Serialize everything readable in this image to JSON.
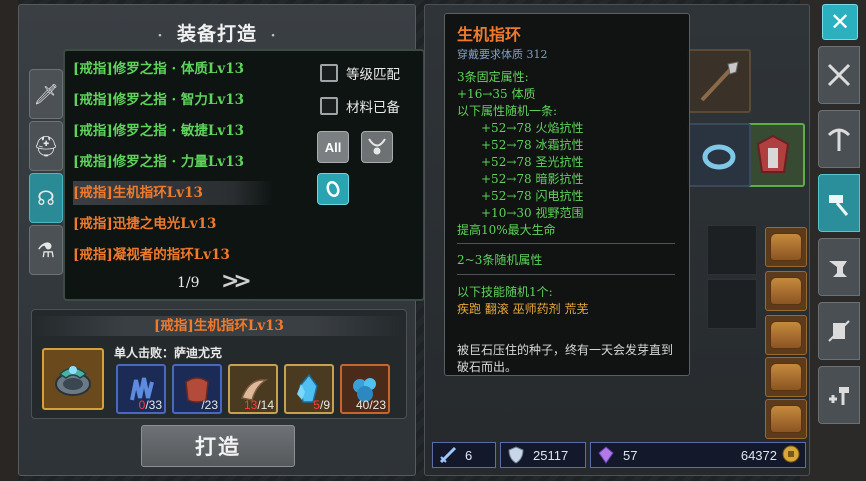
{
  "left_panel": {
    "title": "装备打造",
    "title_deco_left": "·",
    "title_deco_right": "·",
    "side_tabs": [
      {
        "icon": "sword-icon",
        "active": false
      },
      {
        "icon": "helmet-icon",
        "active": false
      },
      {
        "icon": "necklace-icon",
        "active": true
      },
      {
        "icon": "potion-icon",
        "active": false
      }
    ],
    "recipe_list": [
      {
        "label": "[戒指]修罗之指 · 体质Lv13",
        "rarity": "green"
      },
      {
        "label": "[戒指]修罗之指 · 智力Lv13",
        "rarity": "green"
      },
      {
        "label": "[戒指]修罗之指 · 敏捷Lv13",
        "rarity": "green"
      },
      {
        "label": "[戒指]修罗之指 · 力量Lv13",
        "rarity": "green"
      },
      {
        "label": "[戒指]生机指环Lv13",
        "rarity": "orange",
        "selected": true
      },
      {
        "label": "[戒指]迅捷之电光Lv13",
        "rarity": "orange"
      },
      {
        "label": "[戒指]凝视者的指环Lv13",
        "rarity": "orange"
      }
    ],
    "filters": {
      "level_match": "等级匹配",
      "materials_ready": "材料已备",
      "all_button": "All"
    },
    "pager": {
      "text": "1/9",
      "next": ">>"
    },
    "craft": {
      "item_name": "[戒指]生机指环Lv13",
      "kill_text": "单人击败：萨迪尤克",
      "materials": [
        {
          "name": "blue-gloves",
          "have": "0",
          "need": "/33",
          "enough": false
        },
        {
          "name": "red-leather",
          "have": "",
          "need": "/23",
          "enough": true
        },
        {
          "name": "claw",
          "have": "13",
          "need": "/14",
          "enough": false
        },
        {
          "name": "blue-crystal",
          "have": "5",
          "need": "/9",
          "enough": false
        },
        {
          "name": "blue-ore",
          "have": "40",
          "need": "/23",
          "enough": true
        }
      ],
      "button": "打造"
    }
  },
  "tooltip": {
    "title": "生机指环",
    "requirement": "穿戴要求体质  312",
    "fixed_header": "3条固定属性:",
    "fixed_1": "+16→35  体质",
    "random_header": "以下属性随机一条:",
    "random_lines": [
      "+52→78  火焰抗性",
      "+52→78  冰霜抗性",
      "+52→78  圣光抗性",
      "+52→78  暗影抗性",
      "+52→78  闪电抗性",
      "+10→30  视野范围"
    ],
    "fixed_2": "提高10%最大生命",
    "random_count": "2~3条随机属性",
    "skill_header": "以下技能随机1个:",
    "skills": "疾跑  翻滚  巫师药剂  荒芜",
    "description": "被巨石压住的种子，终有一天会发芽直到破石而出。"
  },
  "status_bar": {
    "attack": "6",
    "defense": "25117",
    "gems": "57",
    "gold": "64372"
  },
  "colors": {
    "green_item": "#5ed35a",
    "orange_item": "#f07a2c",
    "teal_active": "#2a8f9b"
  }
}
